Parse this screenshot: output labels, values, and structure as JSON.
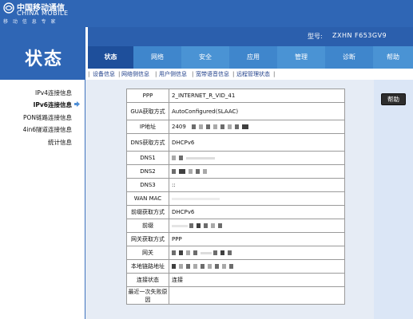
{
  "brand": {
    "name_cn": "中国移动通信",
    "name_en": "CHINA MOBILE",
    "slogan": "移 动 信 息 专 家",
    "logo_icon": "china-mobile-logo"
  },
  "page_title": "状态",
  "model": {
    "label": "型号:",
    "value": "ZXHN F653GV9"
  },
  "tabs": [
    {
      "label": "状态",
      "active": true
    },
    {
      "label": "网络"
    },
    {
      "label": "安全"
    },
    {
      "label": "应用"
    },
    {
      "label": "管理"
    },
    {
      "label": "诊断"
    },
    {
      "label": "帮助"
    }
  ],
  "submenu": [
    {
      "label": "设备信息"
    },
    {
      "label": "网络侧信息",
      "active": true
    },
    {
      "label": "用户侧信息"
    },
    {
      "label": "宽带语音信息"
    },
    {
      "label": "远程管理状态"
    }
  ],
  "sidebar": [
    {
      "label": "IPv4连接信息"
    },
    {
      "label": "IPv6连接信息",
      "active": true
    },
    {
      "label": "PON链路连接信息"
    },
    {
      "label": "4in6隧道连接信息"
    },
    {
      "label": "统计信息"
    }
  ],
  "help_button": "帮助",
  "connection": {
    "ppp": {
      "label": "PPP",
      "value": "2_INTERNET_R_VID_41"
    },
    "gua_mode": {
      "label": "GUA获取方式",
      "value": "AutoConfigured(SLAAC)"
    },
    "ip": {
      "label": "IP地址",
      "value": "2409"
    },
    "dns_mode": {
      "label": "DNS获取方式",
      "value": "DHCPv6"
    },
    "dns1": {
      "label": "DNS1",
      "value": ""
    },
    "dns2": {
      "label": "DNS2",
      "value": ""
    },
    "dns3": {
      "label": "DNS3",
      "value": "::"
    },
    "wan_mac": {
      "label": "WAN MAC",
      "value": ""
    },
    "prefix_mode": {
      "label": "前缀获取方式",
      "value": "DHCPv6"
    },
    "prefix": {
      "label": "前缀",
      "value": ""
    },
    "gw_mode": {
      "label": "网关获取方式",
      "value": "PPP"
    },
    "gateway": {
      "label": "网关",
      "value": ""
    },
    "link_local": {
      "label": "本地链路地址",
      "value": ""
    },
    "conn_status": {
      "label": "连接状态",
      "value": "连接"
    },
    "last_fail": {
      "label": "最近一次失败原因",
      "value": ""
    }
  }
}
